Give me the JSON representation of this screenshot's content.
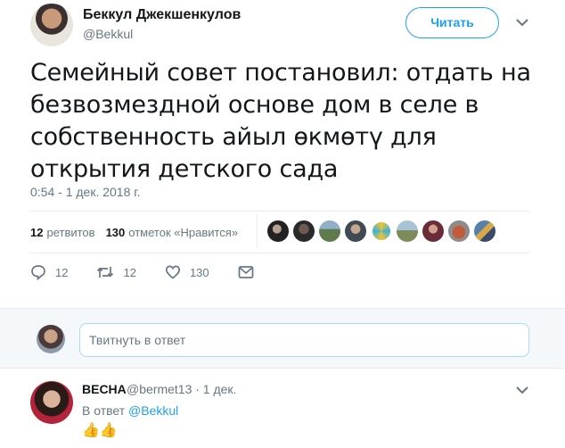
{
  "author": {
    "name": "Беккул Джекшенкулов",
    "handle": "@Bekkul"
  },
  "follow_label": "Читать",
  "tweet": {
    "text": "Семейный совет постановил: отдать на безвозмездной основе дом в селе в собственность айыл өкмөтү для открытия детского сада",
    "timestamp": "0:54 - 1 дек. 2018 г."
  },
  "stats": {
    "retweets_count": "12",
    "retweets_label": "ретвитов",
    "likes_count": "130",
    "likes_label": "отметок «Нравится»"
  },
  "actions": {
    "replies": "12",
    "retweets": "12",
    "likes": "130"
  },
  "reply_box": {
    "placeholder": "Твитнуть в ответ"
  },
  "reply": {
    "name": "ВЕСНА",
    "meta": "@bermet13 · 1 дек.",
    "in_reply_prefix": "В ответ",
    "in_reply_handle": "@Bekkul",
    "text": "👍👍"
  },
  "colors": {
    "accent": "#1da1f2",
    "muted": "#657786",
    "text": "#14171a"
  }
}
